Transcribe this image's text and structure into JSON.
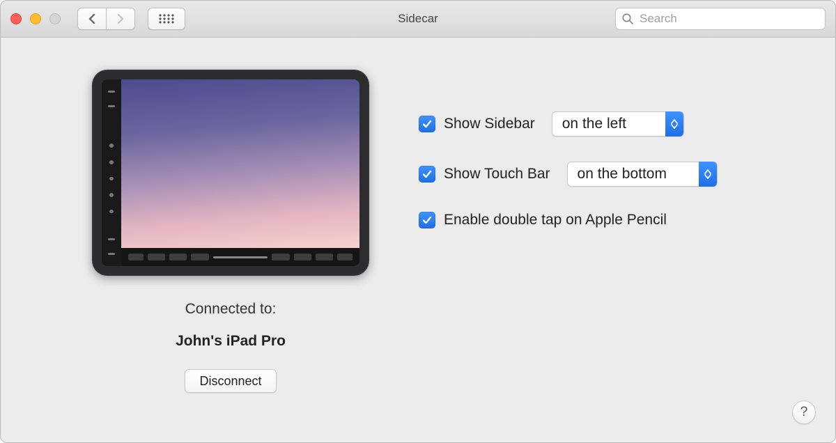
{
  "window": {
    "title": "Sidecar",
    "search_placeholder": "Search"
  },
  "device": {
    "connected_label": "Connected to:",
    "name": "John's iPad Pro",
    "disconnect_label": "Disconnect"
  },
  "options": {
    "show_sidebar": {
      "label": "Show Sidebar",
      "checked": true,
      "selected": "on the left"
    },
    "show_touchbar": {
      "label": "Show Touch Bar",
      "checked": true,
      "selected": "on the bottom"
    },
    "double_tap": {
      "label": "Enable double tap on Apple Pencil",
      "checked": true
    }
  },
  "help_label": "?",
  "colors": {
    "accent": "#1f6fe7"
  }
}
